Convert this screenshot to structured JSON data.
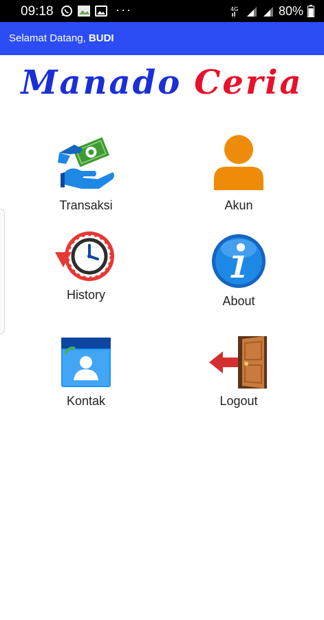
{
  "status_bar": {
    "time": "09:18",
    "battery": "80%",
    "more": "···"
  },
  "app_bar": {
    "greeting": "Selamat Datang,",
    "user": "BUDI",
    "color": "#2c4cf5"
  },
  "logo": {
    "word1": "Manado",
    "word2": "Ceria",
    "word1_color": "#1a2fd6",
    "word2_color": "#e8102a"
  },
  "menu": {
    "transaksi": {
      "label": "Transaksi",
      "icon": "money-hand-icon"
    },
    "akun": {
      "label": "Akun",
      "icon": "user-icon"
    },
    "history": {
      "label": "History",
      "icon": "history-clock-icon"
    },
    "about": {
      "label": "About",
      "icon": "info-icon"
    },
    "kontak": {
      "label": "Kontak",
      "icon": "contacts-icon"
    },
    "logout": {
      "label": "Logout",
      "icon": "logout-door-icon"
    }
  }
}
